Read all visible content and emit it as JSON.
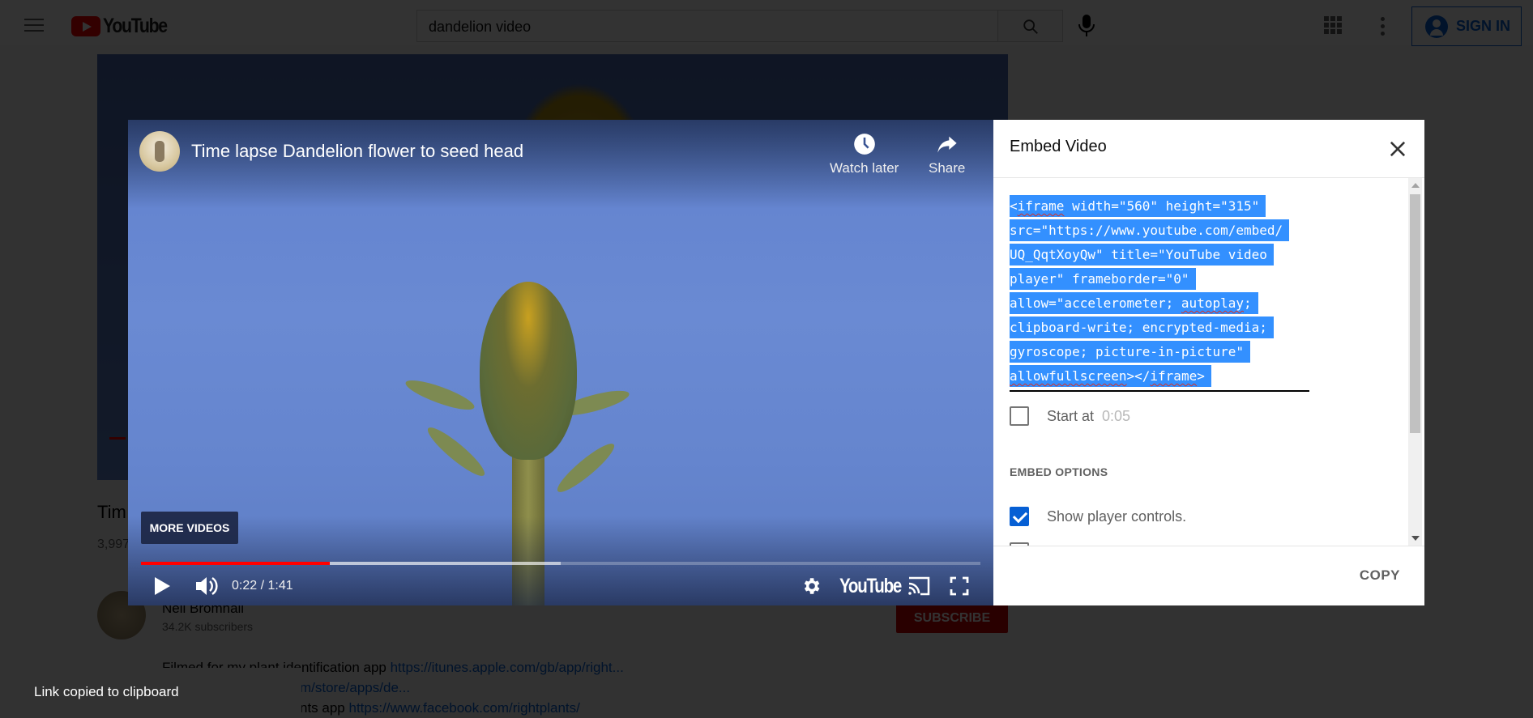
{
  "masthead": {
    "brand": "YouTube",
    "search_value": "dandelion video",
    "sign_in_label": "SIGN IN",
    "brand_color": "#ff0000",
    "accent_color": "#065fd4"
  },
  "watch_page": {
    "title_partial": "Tim",
    "views_partial": "3,997",
    "channel_name": "Neil Bromhall",
    "subscribers": "34.2K subscribers",
    "subscribe_label": "SUBSCRIBE",
    "description": {
      "line1_text": "Filmed for my plant identification app ",
      "line1_link": "https://itunes.apple.com/gb/app/right...",
      "line2_link": "m/store/apps/de...",
      "line3_text": "nts app ",
      "line3_link": "https://www.facebook.com/rightplants/"
    }
  },
  "player": {
    "title": "Time lapse Dandelion flower to seed head",
    "watch_later_label": "Watch later",
    "share_label": "Share",
    "more_videos_label": "MORE VIDEOS",
    "current_time": "0:22",
    "duration": "1:41",
    "time_display": "0:22 / 1:41",
    "played_fraction": 0.225,
    "buffered_fraction": 0.5,
    "brand": "YouTube"
  },
  "embed_dialog": {
    "title": "Embed Video",
    "code_lines": [
      "<iframe width=\"560\" height=\"315\"",
      "src=\"https://www.youtube.com/embed/",
      "UQ_QqtXoyQw\" title=\"YouTube video",
      "player\" frameborder=\"0\"",
      "allow=\"accelerometer; autoplay;",
      "clipboard-write; encrypted-media;",
      "gyroscope; picture-in-picture\"",
      "allowfullscreen></iframe>"
    ],
    "start_at_label": "Start at",
    "start_at_value": "0:05",
    "start_at_checked": false,
    "section_header": "EMBED OPTIONS",
    "options": [
      {
        "label": "Show player controls.",
        "checked": true
      }
    ],
    "copy_label": "COPY"
  },
  "toast": {
    "message": "Link copied to clipboard"
  }
}
